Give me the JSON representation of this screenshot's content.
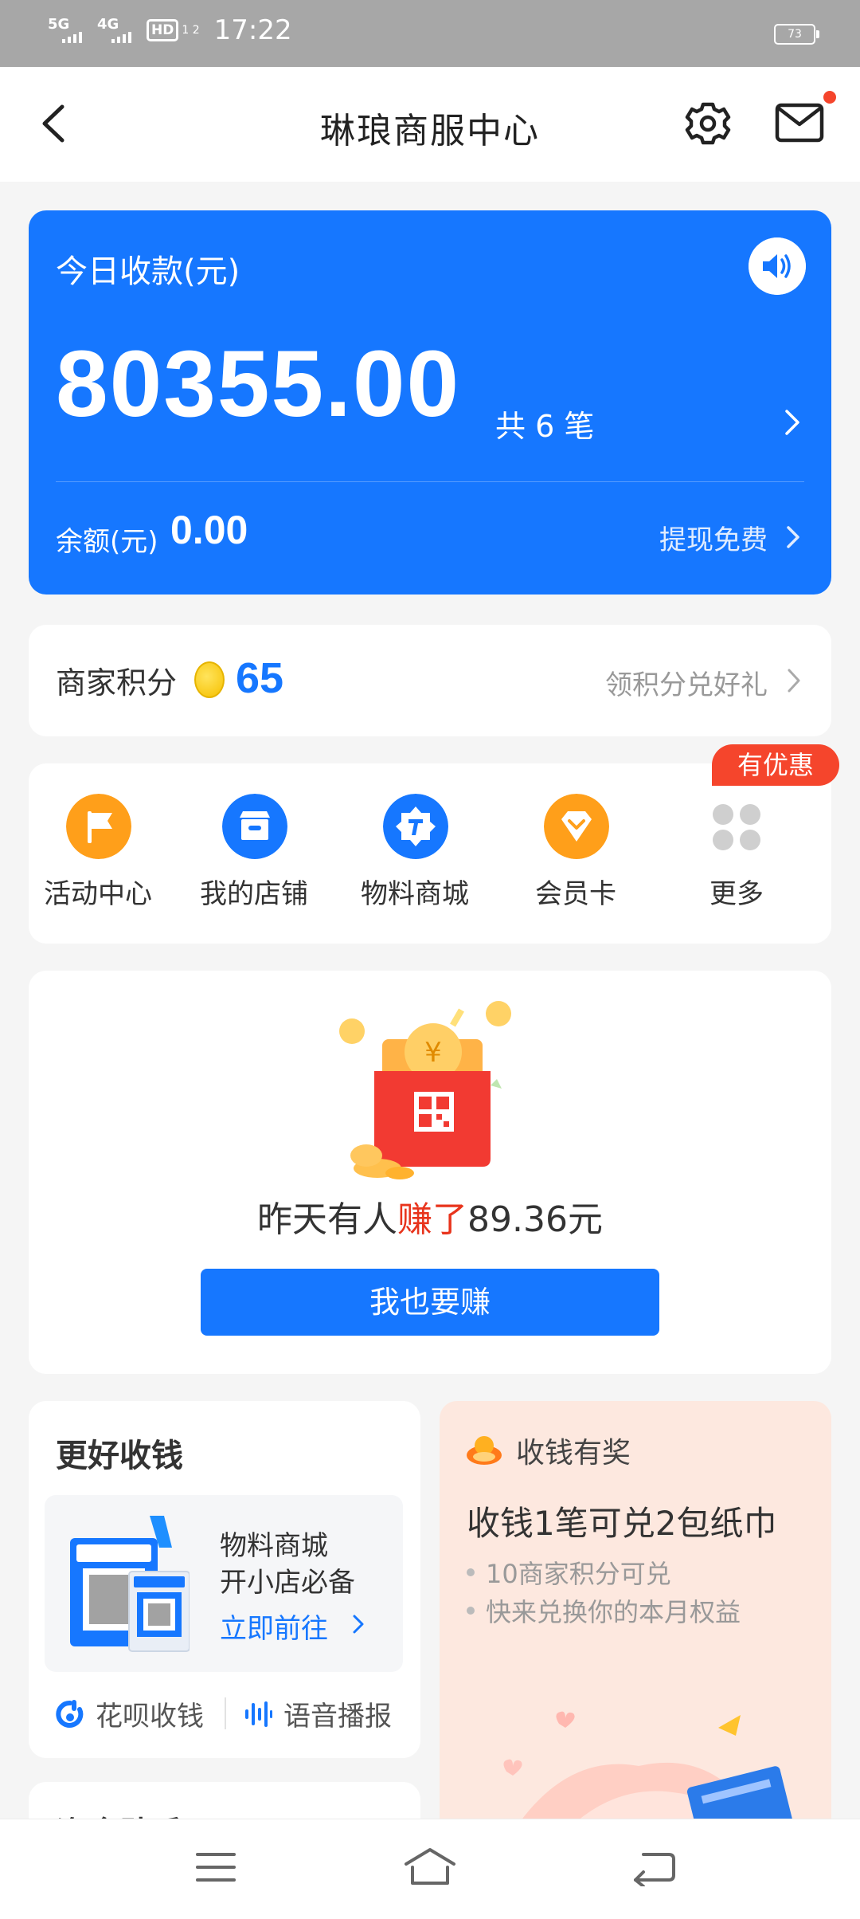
{
  "status_bar": {
    "signal1": "5G",
    "signal2": "4G",
    "hd": "HD",
    "hd_sub": "1 2",
    "time": "17:22",
    "battery": "73"
  },
  "header": {
    "title": "琳琅商服中心",
    "icons": [
      "back-arrow-icon",
      "gear-icon",
      "mail-icon"
    ]
  },
  "revenue": {
    "label": "今日收款(元)",
    "amount": "80355.00",
    "count": "共 6 笔",
    "balance_label": "余额(元)",
    "balance": "0.00",
    "withdraw": "提现免费",
    "accent": "#1677ff"
  },
  "points": {
    "label": "商家积分",
    "value": "65",
    "link": "领积分兑好礼"
  },
  "menu": {
    "items": [
      {
        "label": "活动中心",
        "icon": "flag-icon",
        "color": "#ff9f1a"
      },
      {
        "label": "我的店铺",
        "icon": "store-icon",
        "color": "#1677ff"
      },
      {
        "label": "物料商城",
        "icon": "badge-t-icon",
        "color": "#1677ff"
      },
      {
        "label": "会员卡",
        "icon": "diamond-icon",
        "color": "#ff9f1a"
      },
      {
        "label": "更多",
        "icon": "more-dots-icon",
        "color": "#cccccc"
      }
    ],
    "badge": "有优惠"
  },
  "promo": {
    "text_before": "昨天有人",
    "text_highlight": "赚了",
    "text_after": "89.36元",
    "button": "我也要赚"
  },
  "better": {
    "title": "更好收钱",
    "line1": "物料商城",
    "line2": "开小店必备",
    "go": "立即前往",
    "foot1": "花呗收钱",
    "foot2": "语音播报"
  },
  "reward": {
    "head": "收钱有奖",
    "title": "收钱1笔可兑2包纸巾",
    "bullet1": "10商家积分可兑",
    "bullet2": "快来兑换你的本月权益"
  },
  "fund": {
    "title": "资金助手"
  }
}
